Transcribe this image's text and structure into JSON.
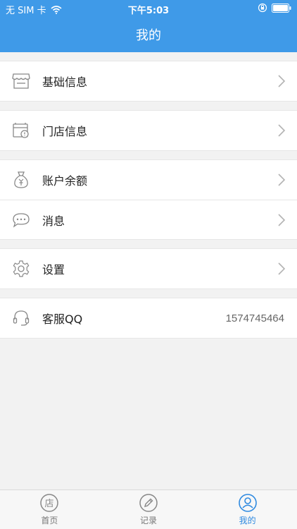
{
  "status_bar": {
    "carrier": "无 SIM 卡",
    "time": "下午5:03"
  },
  "nav": {
    "title": "我的"
  },
  "menu": [
    {
      "label": "基础信息",
      "icon": "store-icon"
    },
    {
      "label": "门店信息",
      "icon": "shop-info-icon"
    },
    {
      "label": "账户余额",
      "icon": "money-bag-icon"
    },
    {
      "label": "消息",
      "icon": "message-icon"
    },
    {
      "label": "设置",
      "icon": "gear-icon"
    },
    {
      "label": "客服QQ",
      "icon": "headset-icon",
      "value": "1574745464"
    }
  ],
  "tabbar": {
    "items": [
      {
        "label": "首页",
        "icon_text": "店"
      },
      {
        "label": "记录"
      },
      {
        "label": "我的"
      }
    ],
    "active_index": 2
  },
  "colors": {
    "primary": "#3f9ae8",
    "active_tab": "#2f8ae0"
  }
}
